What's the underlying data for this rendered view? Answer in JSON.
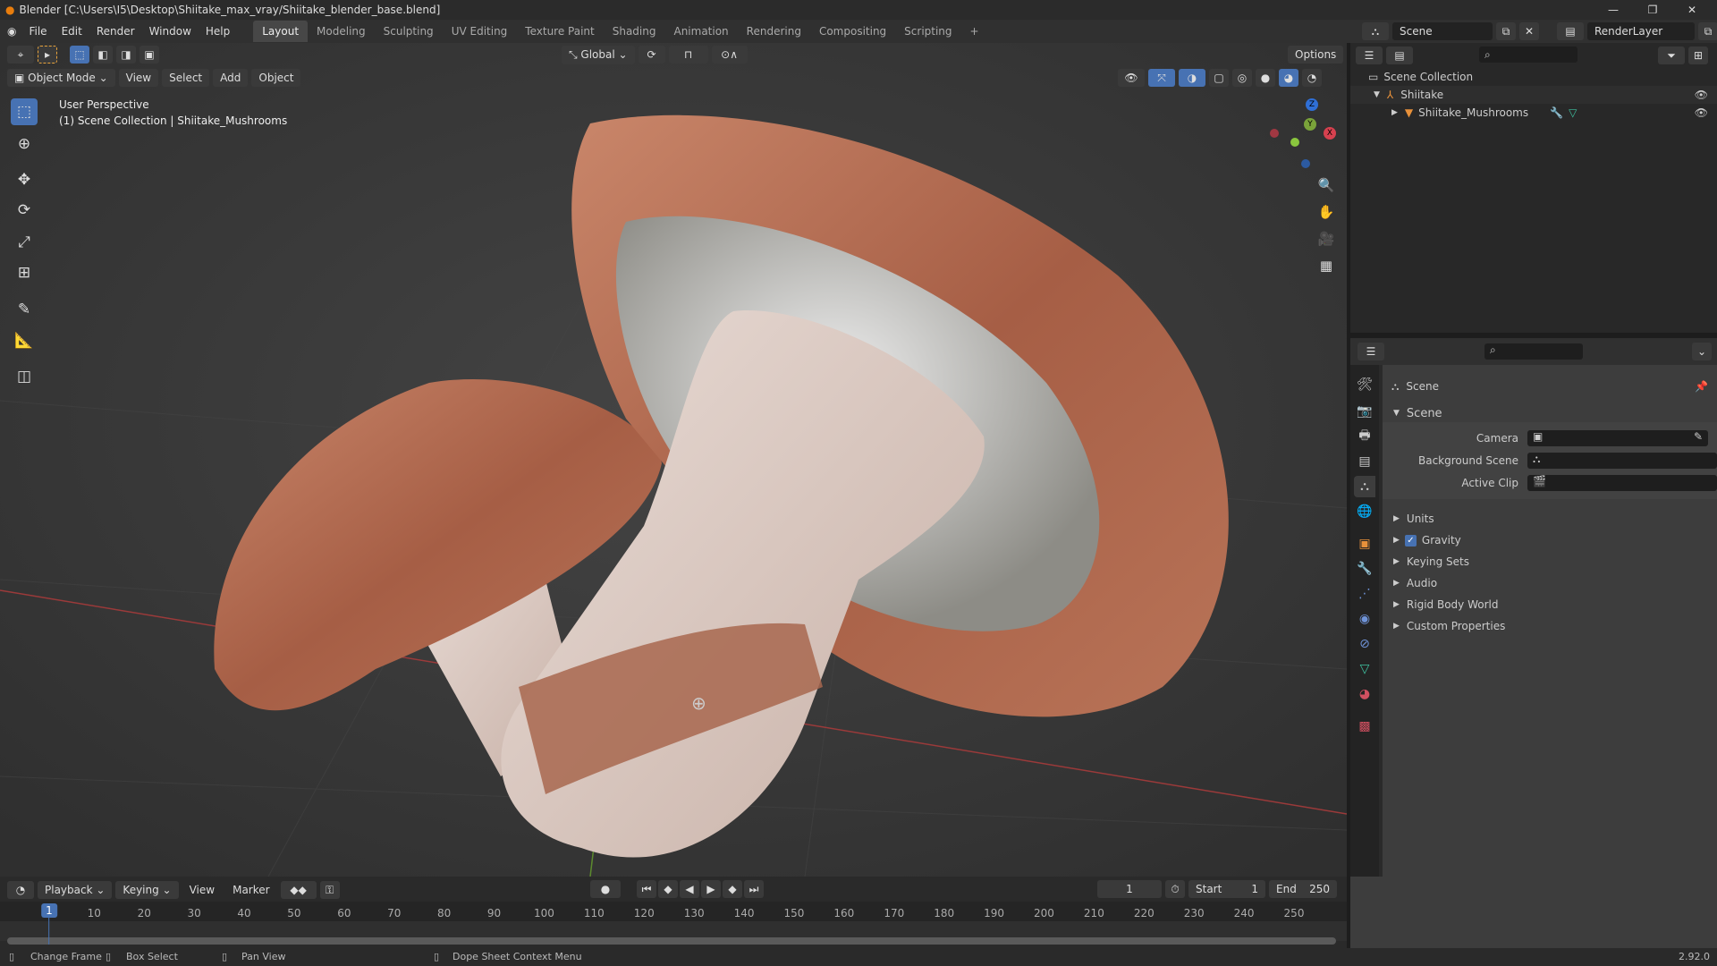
{
  "window": {
    "title": "Blender [C:\\Users\\I5\\Desktop\\Shiitake_max_vray/Shiitake_blender_base.blend]"
  },
  "menus": [
    "File",
    "Edit",
    "Render",
    "Window",
    "Help"
  ],
  "workspaces": [
    "Layout",
    "Modeling",
    "Sculpting",
    "UV Editing",
    "Texture Paint",
    "Shading",
    "Animation",
    "Rendering",
    "Compositing",
    "Scripting",
    "+"
  ],
  "scene_selector": {
    "scene": "Scene",
    "view_layer": "RenderLayer"
  },
  "viewport": {
    "transform_orientation": "Global",
    "options": "Options",
    "mode": "Object Mode",
    "menus": [
      "View",
      "Select",
      "Add",
      "Object"
    ],
    "overlay_line1": "User Perspective",
    "overlay_line2": "(1) Scene Collection | Shiitake_Mushrooms",
    "gizmo": {
      "x": "X",
      "y": "Y",
      "z": "Z"
    }
  },
  "outliner": {
    "root": "Scene Collection",
    "items": [
      {
        "label": "Shiitake"
      },
      {
        "label": "Shiitake_Mushrooms"
      }
    ]
  },
  "properties": {
    "context": "Scene",
    "panel": "Scene",
    "fields": [
      {
        "label": "Camera"
      },
      {
        "label": "Background Scene"
      },
      {
        "label": "Active Clip"
      }
    ],
    "subpanels": [
      {
        "label": "Units"
      },
      {
        "label": "Gravity",
        "checked": true
      },
      {
        "label": "Keying Sets"
      },
      {
        "label": "Audio"
      },
      {
        "label": "Rigid Body World"
      },
      {
        "label": "Custom Properties"
      }
    ]
  },
  "timeline": {
    "menus": [
      "Playback",
      "Keying",
      "View",
      "Marker"
    ],
    "current_frame": "1",
    "start_label": "Start",
    "start": "1",
    "end_label": "End",
    "end": "250",
    "ticks": [
      10,
      20,
      30,
      40,
      50,
      60,
      70,
      80,
      90,
      100,
      110,
      120,
      130,
      140,
      150,
      160,
      170,
      180,
      190,
      200,
      210,
      220,
      230,
      240,
      250
    ],
    "frame_min": 1,
    "frame_max": 250
  },
  "status": {
    "items": [
      "Change Frame",
      "Box Select",
      "Pan View",
      "Dope Sheet Context Menu"
    ],
    "version": "2.92.0"
  },
  "colors": {
    "accent": "#4772b3",
    "background": "#393939"
  }
}
